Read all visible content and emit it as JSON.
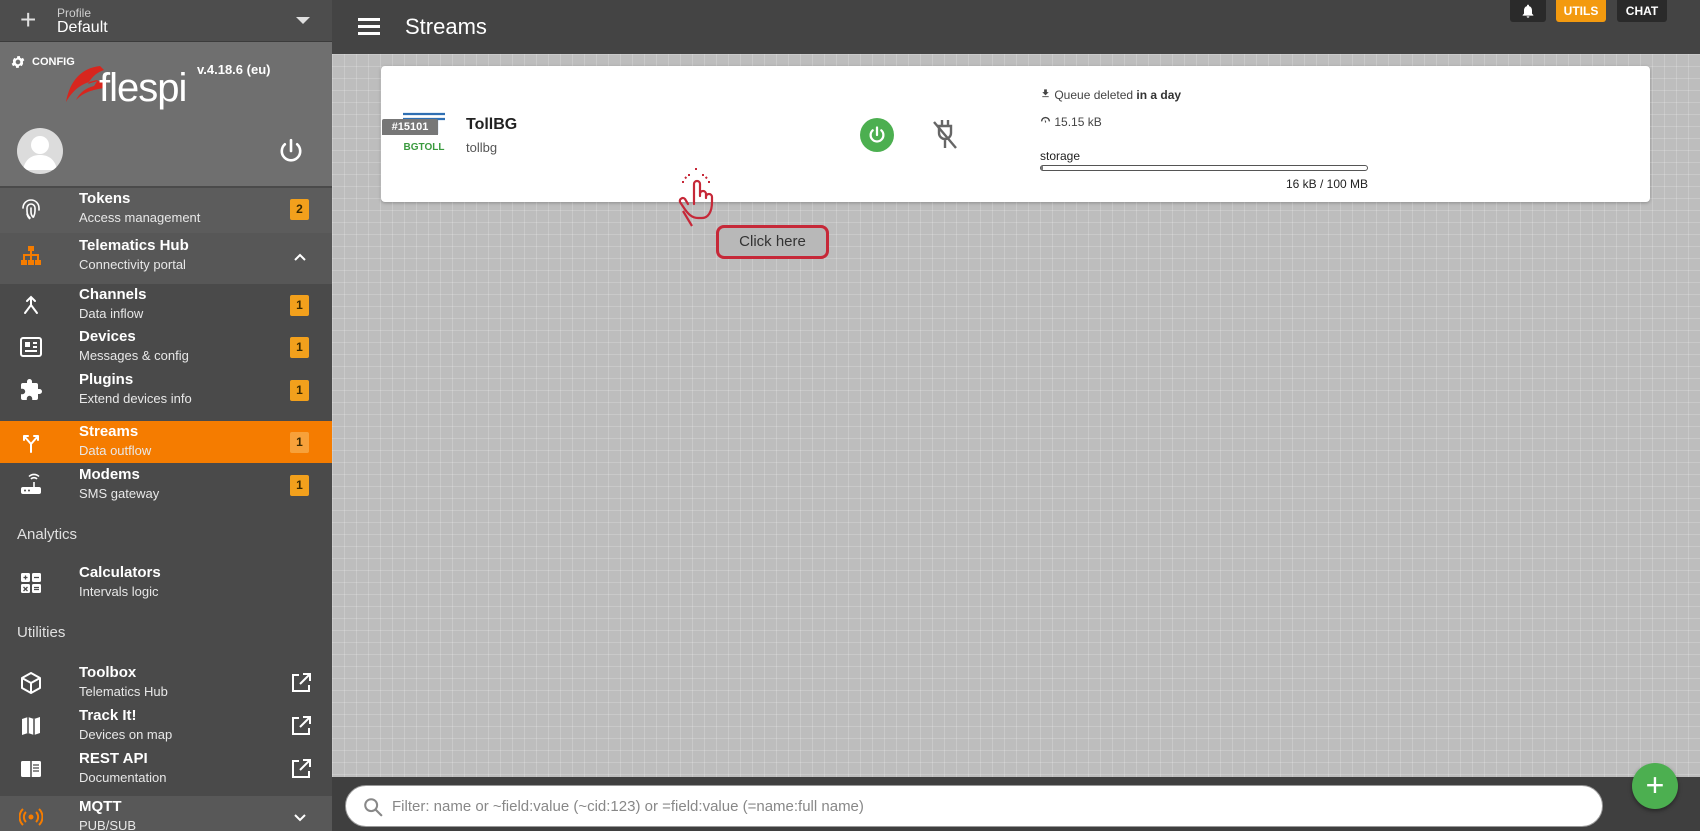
{
  "sidebar": {
    "profile": {
      "label": "Profile",
      "name": "Default"
    },
    "config_label": "CONFIG",
    "version": "v.4.18.6 (eu)",
    "logo_text": "flespi",
    "nav": {
      "tokens": {
        "title": "Tokens",
        "subtitle": "Access management",
        "badge": "2"
      },
      "hub": {
        "title": "Telematics Hub",
        "subtitle": "Connectivity portal"
      },
      "channels": {
        "title": "Channels",
        "subtitle": "Data inflow",
        "badge": "1"
      },
      "devices": {
        "title": "Devices",
        "subtitle": "Messages & config",
        "badge": "1"
      },
      "plugins": {
        "title": "Plugins",
        "subtitle": "Extend devices info",
        "badge": "1"
      },
      "streams": {
        "title": "Streams",
        "subtitle": "Data outflow",
        "badge": "1"
      },
      "modems": {
        "title": "Modems",
        "subtitle": "SMS gateway",
        "badge": "1"
      },
      "analytics_label": "Analytics",
      "calculators": {
        "title": "Calculators",
        "subtitle": "Intervals logic"
      },
      "utilities_label": "Utilities",
      "toolbox": {
        "title": "Toolbox",
        "subtitle": "Telematics Hub"
      },
      "trackit": {
        "title": "Track It!",
        "subtitle": "Devices on map"
      },
      "restapi": {
        "title": "REST API",
        "subtitle": "Documentation"
      },
      "mqtt": {
        "title": "MQTT",
        "subtitle": "PUB/SUB"
      }
    }
  },
  "topbar": {
    "title": "Streams",
    "utils_label": "UTILS",
    "chat_label": "CHAT"
  },
  "stream": {
    "id": "#15101",
    "name": "TollBG",
    "subtitle": "tollbg",
    "logo_text": "BGTOLL",
    "queue_prefix": "Queue deleted",
    "queue_bold": "in a day",
    "size": "15.15 kB",
    "storage_label": "storage",
    "storage_value": "16 kB / 100 MB",
    "storage_fraction": 0.00016
  },
  "overlay": {
    "click_here": "Click here"
  },
  "search": {
    "placeholder": "Filter: name or ~field:value (~cid:123) or =field:value (=name:full name)"
  },
  "colors": {
    "accent": "#f57c00",
    "badge": "#f2a01c",
    "green": "#4caf50",
    "highlight": "#c62838"
  }
}
